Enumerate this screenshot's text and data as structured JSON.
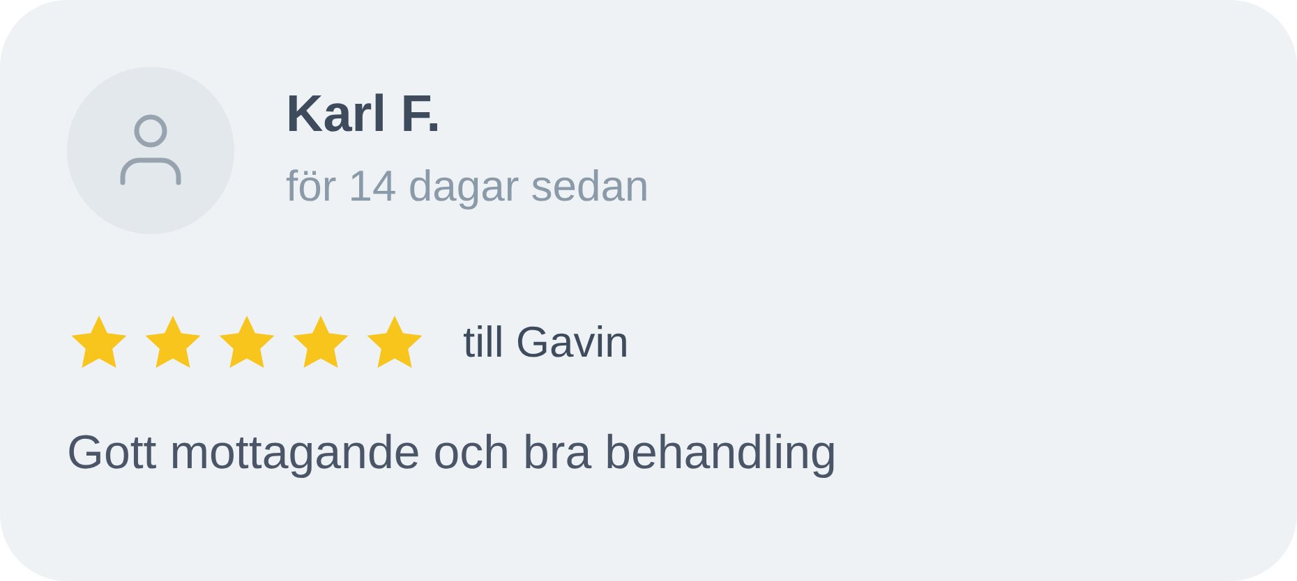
{
  "review": {
    "author": "Karl F.",
    "time": "för 14 dagar sedan",
    "stars": 5,
    "recipient": "till Gavin",
    "text": "Gott mottagande och bra behandling"
  }
}
